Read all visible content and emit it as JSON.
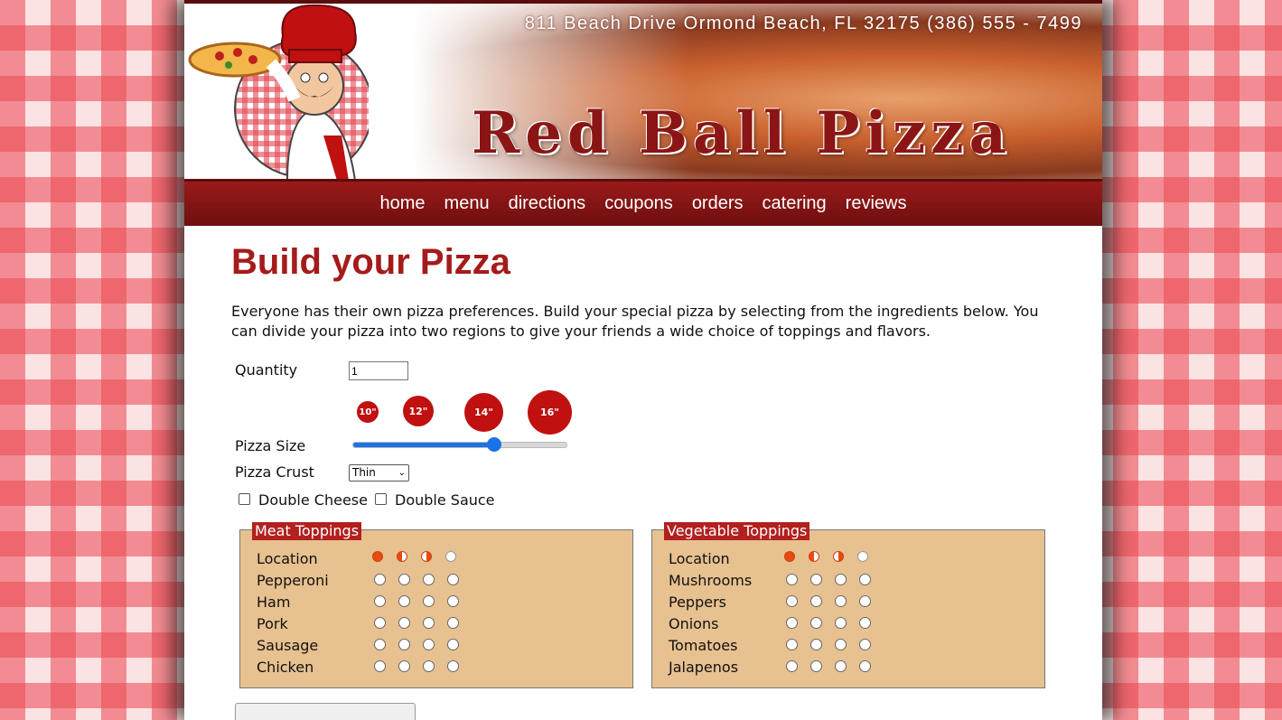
{
  "header": {
    "address": "811 Beach Drive  Ormond Beach, FL  32175   (386) 555 - 7499",
    "brand": "Red Ball Pizza"
  },
  "nav": [
    "home",
    "menu",
    "directions",
    "coupons",
    "orders",
    "catering",
    "reviews"
  ],
  "page": {
    "title": "Build your Pizza",
    "intro": "Everyone has their own pizza preferences. Build your special pizza by selecting from the ingredients below. You can divide your pizza into two regions to give your friends a wide choice of toppings and flavors."
  },
  "form": {
    "quantity_label": "Quantity",
    "quantity_value": "1",
    "size_label": "Pizza Size",
    "sizes": [
      "10\"",
      "12\"",
      "14\"",
      "16\""
    ],
    "size_slider_fraction": 0.66,
    "crust_label": "Pizza Crust",
    "crust_value": "Thin",
    "double_cheese_label": "Double Cheese",
    "double_sauce_label": "Double Sauce"
  },
  "meat": {
    "legend": "Meat Toppings",
    "location_label": "Location",
    "items": [
      "Pepperoni",
      "Ham",
      "Pork",
      "Sausage",
      "Chicken"
    ]
  },
  "veg": {
    "legend": "Vegetable Toppings",
    "location_label": "Location",
    "items": [
      "Mushrooms",
      "Peppers",
      "Onions",
      "Tomatoes",
      "Jalapenos"
    ]
  },
  "colors": {
    "brand_red": "#a51b1b",
    "nav_bg": "#8b1515",
    "toppings_bg": "#e8c190",
    "location_accent": "#e84a10"
  }
}
